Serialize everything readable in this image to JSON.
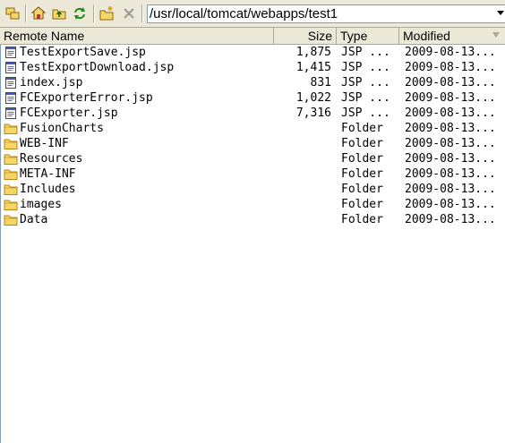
{
  "toolbar": {
    "buttons": [
      {
        "name": "new-connection-icon"
      },
      {
        "name": "home-folder-icon"
      },
      {
        "name": "parent-folder-icon"
      },
      {
        "name": "refresh-icon"
      },
      {
        "name": "new-folder-icon"
      },
      {
        "name": "delete-icon"
      }
    ],
    "path": "/usr/local/tomcat/webapps/test1"
  },
  "columns": {
    "name": "Remote Name",
    "size": "Size",
    "type": "Type",
    "modified": "Modified"
  },
  "rows": [
    {
      "icon": "jsp-file-icon",
      "name": "TestExportSave.jsp",
      "size": "1,875",
      "type": "JSP ...",
      "modified": "2009-08-13..."
    },
    {
      "icon": "jsp-file-icon",
      "name": "TestExportDownload.jsp",
      "size": "1,415",
      "type": "JSP ...",
      "modified": "2009-08-13..."
    },
    {
      "icon": "jsp-file-icon",
      "name": "index.jsp",
      "size": "831",
      "type": "JSP ...",
      "modified": "2009-08-13..."
    },
    {
      "icon": "jsp-file-icon",
      "name": "FCExporterError.jsp",
      "size": "1,022",
      "type": "JSP ...",
      "modified": "2009-08-13..."
    },
    {
      "icon": "jsp-file-icon",
      "name": "FCExporter.jsp",
      "size": "7,316",
      "type": "JSP ...",
      "modified": "2009-08-13..."
    },
    {
      "icon": "folder-icon",
      "name": "FusionCharts",
      "size": "",
      "type": "Folder",
      "modified": "2009-08-13..."
    },
    {
      "icon": "folder-icon",
      "name": "WEB-INF",
      "size": "",
      "type": "Folder",
      "modified": "2009-08-13..."
    },
    {
      "icon": "folder-icon",
      "name": "Resources",
      "size": "",
      "type": "Folder",
      "modified": "2009-08-13..."
    },
    {
      "icon": "folder-icon",
      "name": "META-INF",
      "size": "",
      "type": "Folder",
      "modified": "2009-08-13..."
    },
    {
      "icon": "folder-icon",
      "name": "Includes",
      "size": "",
      "type": "Folder",
      "modified": "2009-08-13..."
    },
    {
      "icon": "folder-icon",
      "name": "images",
      "size": "",
      "type": "Folder",
      "modified": "2009-08-13..."
    },
    {
      "icon": "folder-icon",
      "name": "Data",
      "size": "",
      "type": "Folder",
      "modified": "2009-08-13..."
    }
  ],
  "colors": {
    "toolbar_bg": "#ece9d8",
    "folder_yellow": "#f5d66a",
    "folder_outline": "#b8860b",
    "file_blue": "#3a5fcd"
  }
}
